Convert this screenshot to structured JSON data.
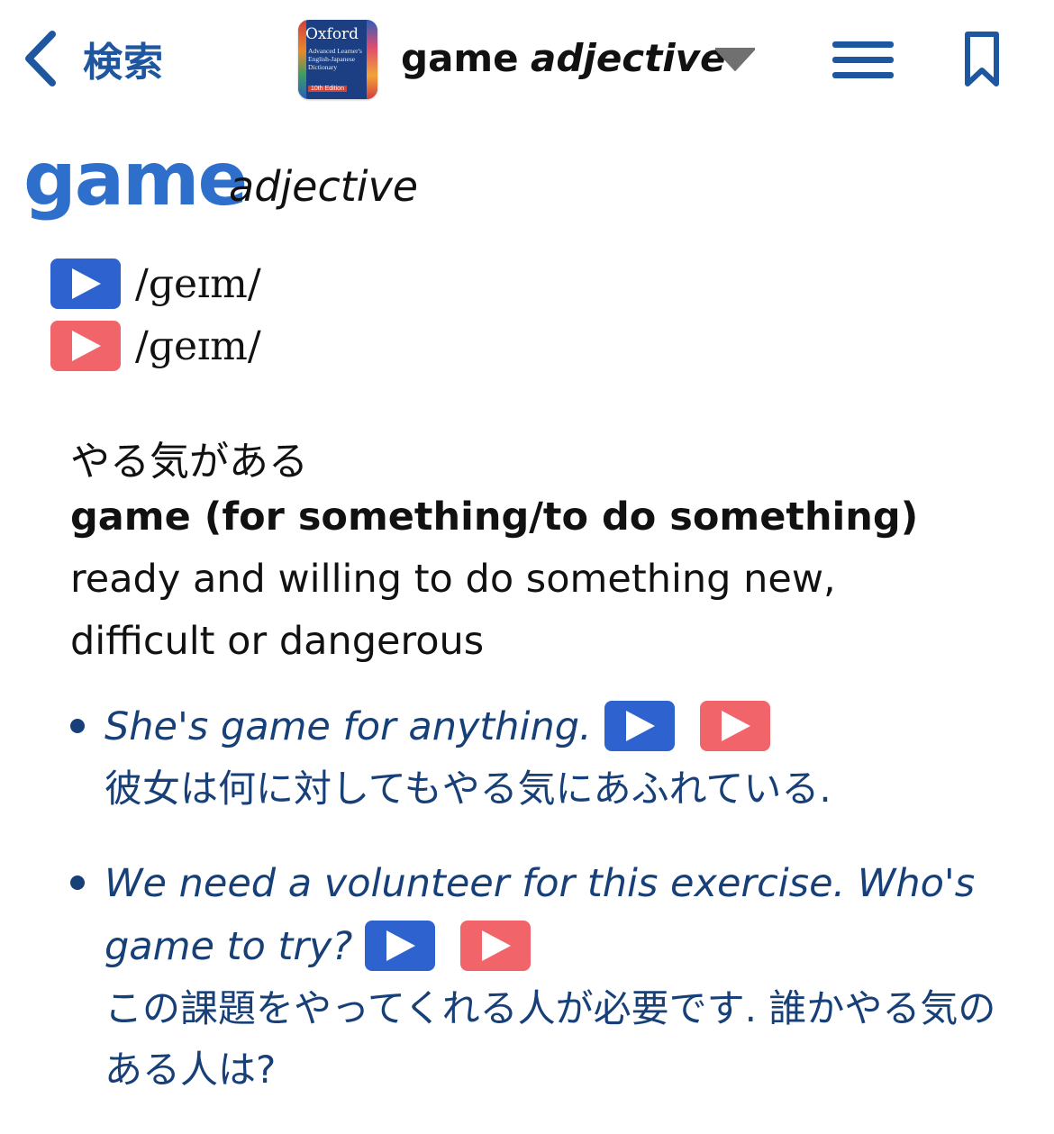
{
  "nav": {
    "back_label": "検索",
    "app_icon": {
      "name": "Oxford",
      "subtitle": "Advanced Learner's English-Japanese Dictionary",
      "edition": "10th Edition"
    },
    "title_word": "game",
    "title_pos": "adjective",
    "icons": {
      "back": "chevron-left-icon",
      "dropdown": "triangle-down-icon",
      "menu": "hamburger-menu-icon",
      "bookmark": "bookmark-icon"
    }
  },
  "entry": {
    "headword": "game",
    "pos": "adjective",
    "pronunciations": [
      {
        "variant": "uk",
        "ipa": "/ɡeɪm/",
        "color": "#2e63cf"
      },
      {
        "variant": "us",
        "ipa": "/ɡeɪm/",
        "color": "#f0646a"
      }
    ],
    "sense": {
      "ja_gloss": "やる気がある",
      "grammar": "game (for something/to do something)",
      "definition": " ready and willing to do something new, difficult or dangerous",
      "examples": [
        {
          "en": "She's game for anything.",
          "ja": "彼女は何に対してもやる気にあふれている."
        },
        {
          "en": "We need a volunteer for this exercise. Who's game to try?",
          "ja": "この課題をやってくれる人が必要です. 誰かやる気のある人は?"
        }
      ]
    }
  },
  "colors": {
    "link_blue": "#1f56a0",
    "headword_blue": "#2f6fcc",
    "example_navy": "#173f78",
    "uk_audio": "#2e63cf",
    "us_audio": "#f0646a"
  }
}
